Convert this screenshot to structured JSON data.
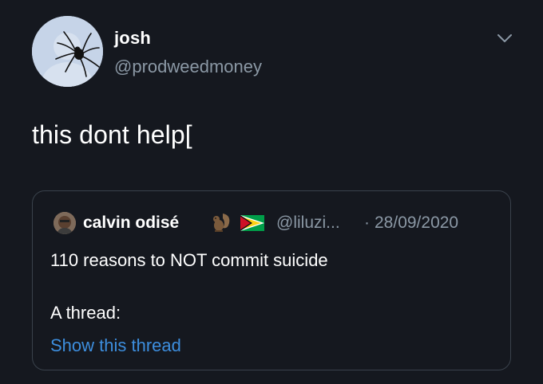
{
  "tweet": {
    "author": {
      "name": "josh",
      "handle": "@prodweedmoney",
      "avatar_icon": "spider-avatar-icon"
    },
    "menu_icon": "chevron-down-icon",
    "text": "this dont help["
  },
  "quoted_tweet": {
    "author": {
      "name": "calvin odisé",
      "handle": "@liluzi...",
      "avatar_icon": "person-avatar-icon",
      "emojis": [
        "squirrel-emoji-icon",
        "guyana-flag-icon"
      ]
    },
    "separator": "·",
    "date": "28/09/2020",
    "text_line1": "110 reasons to NOT commit suicide",
    "text_line2": "A thread:",
    "link_text": "Show this thread"
  },
  "colors": {
    "background": "#15181f",
    "secondary_text": "#8b98a5",
    "link": "#3d8ede",
    "border": "#3a424c"
  }
}
